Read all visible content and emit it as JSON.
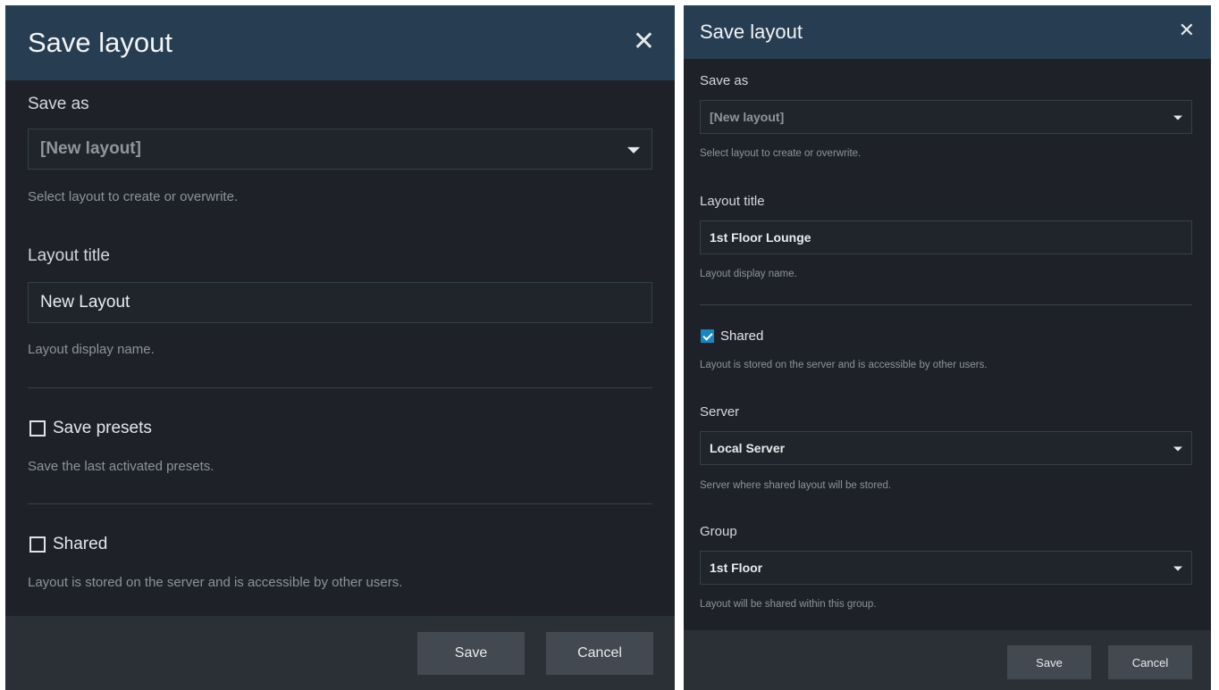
{
  "left_dialog": {
    "title": "Save layout",
    "close_symbol": "✕",
    "save_as": {
      "label": "Save as",
      "selected": "[New layout]",
      "hint": "Select layout to create or overwrite."
    },
    "layout_title": {
      "label": "Layout title",
      "value": "New Layout",
      "hint": "Layout display name."
    },
    "save_presets": {
      "label": "Save presets",
      "checked": false,
      "hint": "Save the last activated presets."
    },
    "shared": {
      "label": "Shared",
      "checked": false,
      "hint": "Layout is stored on the server and is accessible by other users."
    },
    "buttons": {
      "save": "Save",
      "cancel": "Cancel"
    }
  },
  "right_dialog": {
    "title": "Save layout",
    "close_symbol": "✕",
    "save_as": {
      "label": "Save as",
      "selected": "[New layout]",
      "hint": "Select layout to create or overwrite."
    },
    "layout_title": {
      "label": "Layout title",
      "value": "1st Floor Lounge",
      "hint": "Layout display name."
    },
    "shared": {
      "label": "Shared",
      "checked": true,
      "hint": "Layout is stored on the server and is accessible by other users."
    },
    "server": {
      "label": "Server",
      "selected": "Local Server",
      "hint": "Server where shared layout will be stored."
    },
    "group": {
      "label": "Group",
      "selected": "1st Floor",
      "hint": "Layout will be shared within this group."
    },
    "buttons": {
      "save": "Save",
      "cancel": "Cancel"
    }
  },
  "colors": {
    "header_bg": "#263d52",
    "dialog_bg": "#1e2228",
    "footer_bg": "#2b3036",
    "button_bg": "#434951",
    "checkbox_accent": "#1687c4"
  },
  "icons": {
    "close": "close-icon",
    "dropdown": "chevron-down-icon",
    "checkbox": "checkbox-icon"
  }
}
